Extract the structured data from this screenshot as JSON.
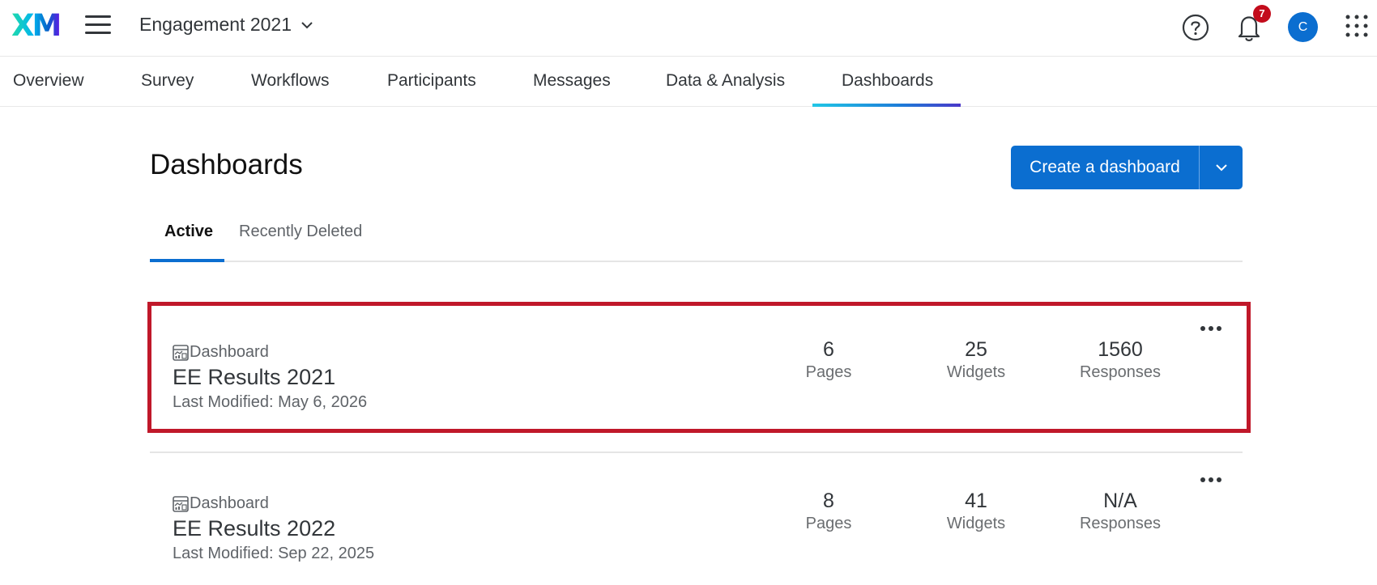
{
  "header": {
    "logo_text": "XM",
    "project_title": "Engagement 2021",
    "notification_count": "7",
    "avatar_initial": "C"
  },
  "nav": {
    "items": [
      {
        "label": "Overview"
      },
      {
        "label": "Survey"
      },
      {
        "label": "Workflows"
      },
      {
        "label": "Participants"
      },
      {
        "label": "Messages"
      },
      {
        "label": "Data & Analysis"
      },
      {
        "label": "Dashboards",
        "active": true
      }
    ]
  },
  "main": {
    "title": "Dashboards",
    "create_button_label": "Create a dashboard",
    "tabs": [
      {
        "label": "Active",
        "active": true
      },
      {
        "label": "Recently Deleted"
      }
    ]
  },
  "dashboards": [
    {
      "type_label": "Dashboard",
      "name": "EE Results 2021",
      "last_modified": "Last Modified: May 6, 2026",
      "pages_value": "6",
      "pages_label": "Pages",
      "widgets_value": "25",
      "widgets_label": "Widgets",
      "responses_value": "1560",
      "responses_label": "Responses",
      "highlighted": true
    },
    {
      "type_label": "Dashboard",
      "name": "EE Results 2022",
      "last_modified": "Last Modified: Sep 22, 2025",
      "pages_value": "8",
      "pages_label": "Pages",
      "widgets_value": "41",
      "widgets_label": "Widgets",
      "responses_value": "N/A",
      "responses_label": "Responses",
      "highlighted": false
    }
  ],
  "colors": {
    "primary": "#0b6ed0",
    "highlight_border": "#c0182a",
    "badge": "#c30c1c"
  }
}
